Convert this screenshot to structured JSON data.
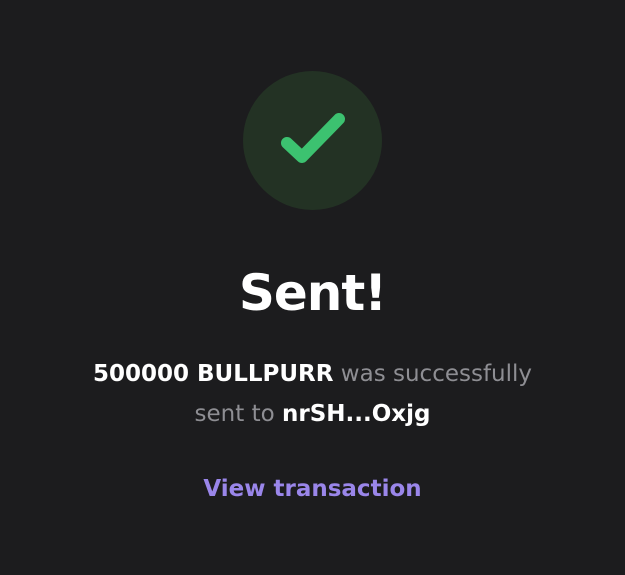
{
  "status": {
    "icon": "checkmark-icon",
    "title": "Sent!"
  },
  "message": {
    "amount": "500000 BULLPURR",
    "text_middle": " was successfully",
    "text_sent_to": "sent to ",
    "recipient": "nrSH...Oxjg"
  },
  "actions": {
    "view_transaction_label": "View transaction"
  },
  "colors": {
    "background": "#1c1c1e",
    "success_green": "#3cc270",
    "success_circle": "#233224",
    "link_purple": "#9a86ea",
    "muted_text": "#8e8e93"
  }
}
